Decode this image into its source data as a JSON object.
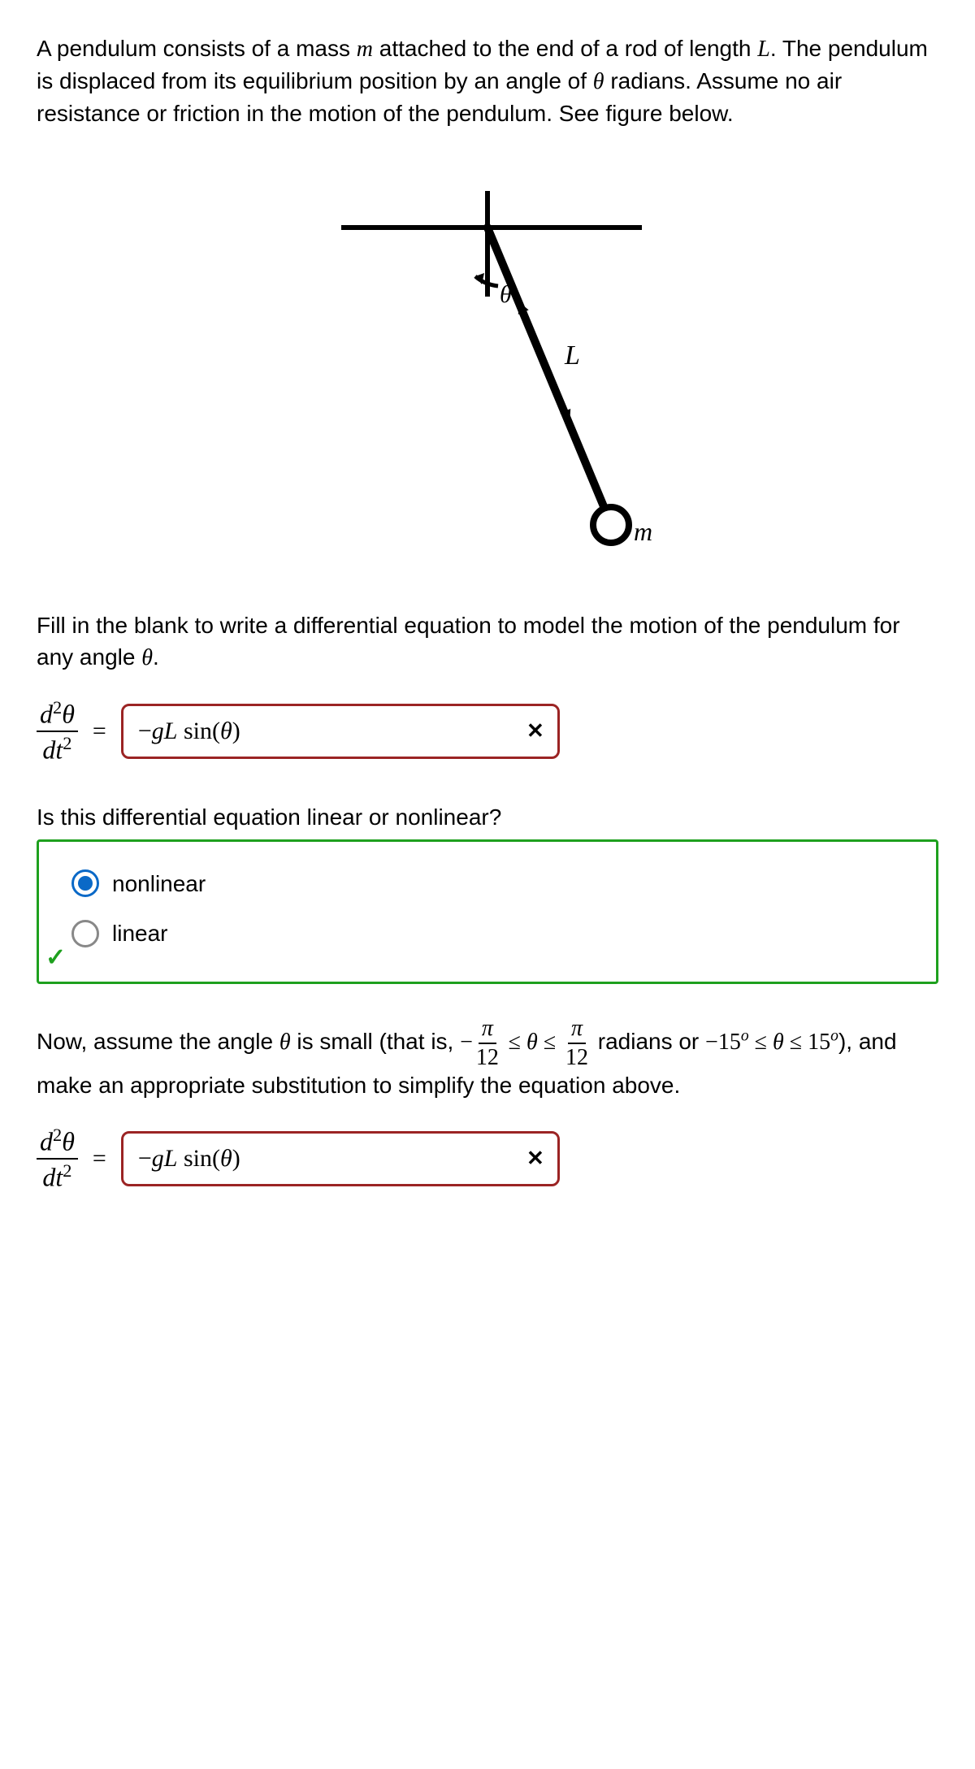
{
  "intro": "A pendulum consists of a mass m attached to the end of a rod of length L. The pendulum is displaced from its equilibrium position by an angle of θ radians. Assume no air resistance or friction in the motion of the pendulum. See figure below.",
  "figure": {
    "theta_label": "θ",
    "L_label": "L",
    "m_label": "m"
  },
  "q1": {
    "prompt": "Fill in the blank to write a differential equation to model the motion of the pendulum for any angle θ.",
    "lhs_num": "d²θ",
    "lhs_den": "dt²",
    "equals": "=",
    "answer": "−gL sin(θ)",
    "status": "wrong"
  },
  "q2": {
    "prompt": "Is this differential equation linear or nonlinear?",
    "options": {
      "a": "nonlinear",
      "b": "linear"
    },
    "selected": "a",
    "status": "correct"
  },
  "q3": {
    "prompt_pre": "Now, assume the angle θ is small (that is, ",
    "range_tex": "−π/12 ≤ θ ≤ π/12",
    "prompt_mid": " radians or −15° ≤ θ ≤ 15°), and make an appropriate substitution to simplify the equation above.",
    "lhs_num": "d²θ",
    "lhs_den": "dt²",
    "equals": "=",
    "answer": "−gL sin(θ)",
    "status": "wrong"
  }
}
